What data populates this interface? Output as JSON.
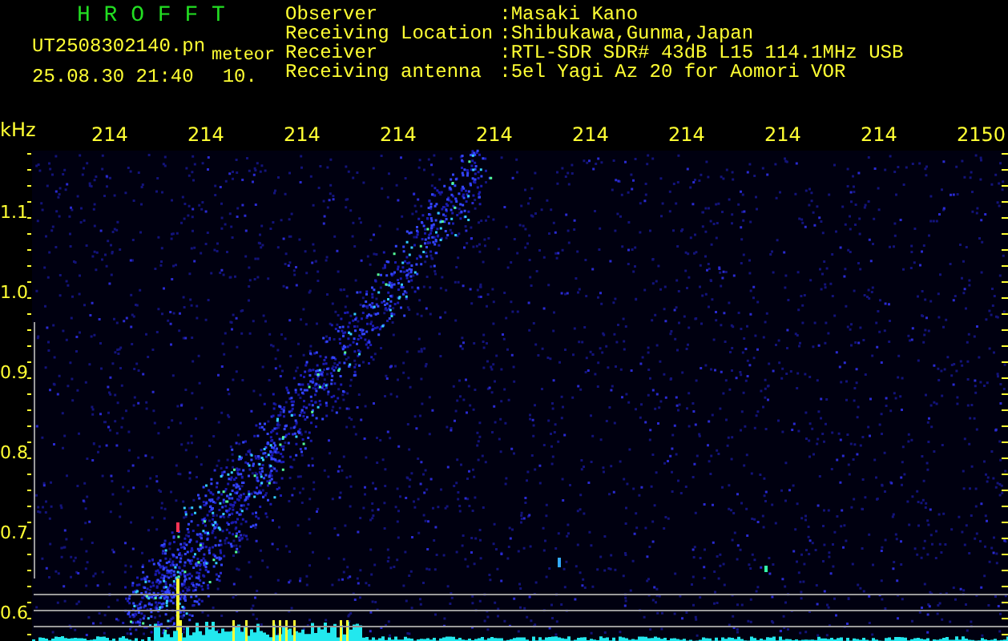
{
  "title": "H R O F F T",
  "file_name": "UT2508302140.pn",
  "tag": "meteor",
  "datetime": "25.08.30 21:40",
  "count": "10.",
  "info": [
    {
      "label": "Observer",
      "value": ":Masaki Kano"
    },
    {
      "label": "Receiving Location",
      "value": ":Shibukawa,Gunma,Japan"
    },
    {
      "label": "Receiver",
      "value": ":RTL-SDR SDR# 43dB L15 114.1MHz USB"
    },
    {
      "label": "Receiving antenna",
      "value": ":5el Yagi Az 20 for Aomori VOR"
    }
  ],
  "spectrogram": {
    "unit": "kHz",
    "x_labels": [
      "214",
      "214",
      "214",
      "214",
      "214",
      "214",
      "214",
      "214",
      "214",
      "2150"
    ],
    "y_labels": [
      "1.1",
      "1.0",
      "0.9",
      "0.8",
      "0.7",
      "0.6"
    ]
  }
}
